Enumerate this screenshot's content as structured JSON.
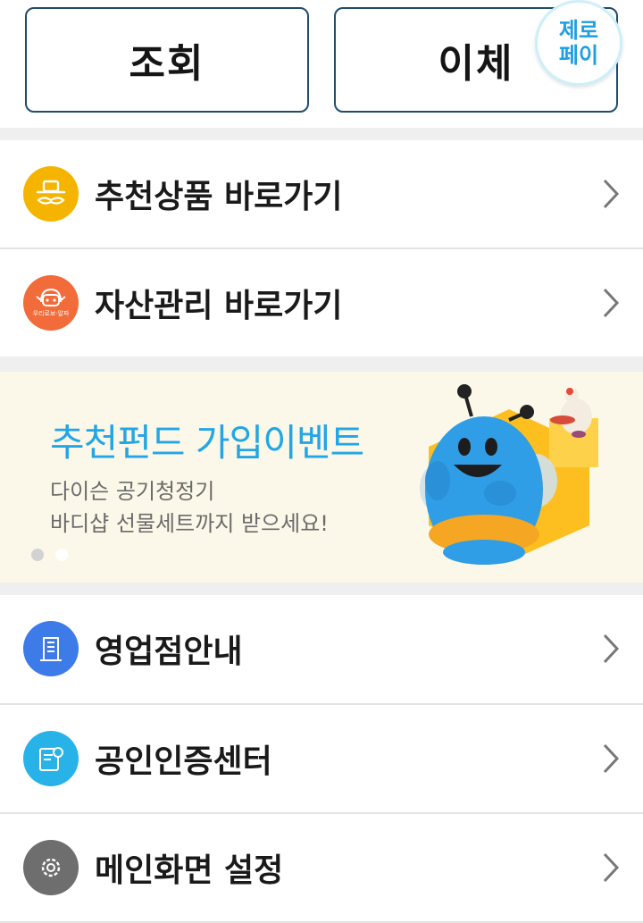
{
  "top_buttons": {
    "inquiry_label": "조회",
    "transfer_label": "이체",
    "zeropay_line1": "제로",
    "zeropay_line2": "페이"
  },
  "menu_top": [
    {
      "label": "추천상품 바로가기",
      "icon": "mustache-hat-icon",
      "icon_color": "#f5b400"
    },
    {
      "label": "자산관리 바로가기",
      "icon": "robot-icon",
      "icon_color": "#f26b3a",
      "icon_text": "우리로보·알파"
    }
  ],
  "banner": {
    "title": "추천펀드 가입이벤트",
    "line1": "다이슨 공기청정기",
    "line2": "바디샵 선물세트까지 받으세요!",
    "total_slides": 2,
    "active_slide": 1
  },
  "menu_bottom": [
    {
      "label": "영업점안내",
      "icon": "building-icon",
      "icon_color": "#3d7be8"
    },
    {
      "label": "공인인증센터",
      "icon": "certificate-icon",
      "icon_color": "#28b3e8"
    },
    {
      "label": "메인화면 설정",
      "icon": "gear-icon",
      "icon_color": "#6e6e6e"
    }
  ]
}
